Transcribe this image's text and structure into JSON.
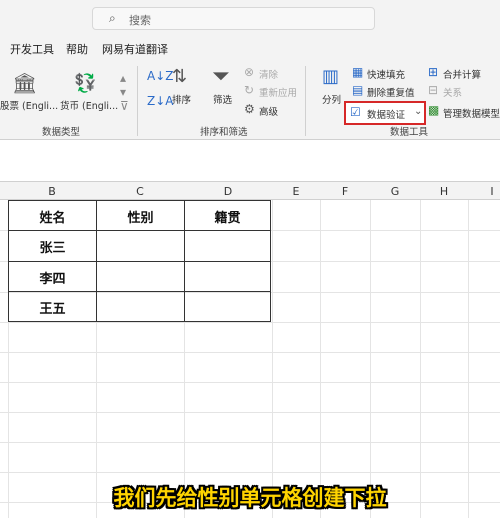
{
  "search": {
    "placeholder": "搜索"
  },
  "menu": {
    "items": [
      "开发工具",
      "帮助",
      "网易有道翻译"
    ]
  },
  "ribbon": {
    "data_types": {
      "stocks": "股票 (Engli...",
      "currency": "货币 (Engli...",
      "group": "数据类型"
    },
    "sort_filter": {
      "sort": "排序",
      "filter": "筛选",
      "clear": "清除",
      "reapply": "重新应用",
      "advanced": "高级",
      "group": "排序和筛选"
    },
    "data_tools": {
      "split": "分列",
      "flash_fill": "快速填充",
      "remove_dup": "删除重复值",
      "validation": "数据验证",
      "merge": "合并计算",
      "relations": "关系",
      "manage_model": "管理数据模型",
      "group": "数据工具"
    }
  },
  "columns": [
    "B",
    "C",
    "D",
    "E",
    "F",
    "G",
    "H",
    "I"
  ],
  "table": {
    "headers": [
      "姓名",
      "性别",
      "籍贯"
    ],
    "names": [
      "张三",
      "李四",
      "王五"
    ]
  },
  "subtitle": "我们先给性别单元格创建下拉"
}
